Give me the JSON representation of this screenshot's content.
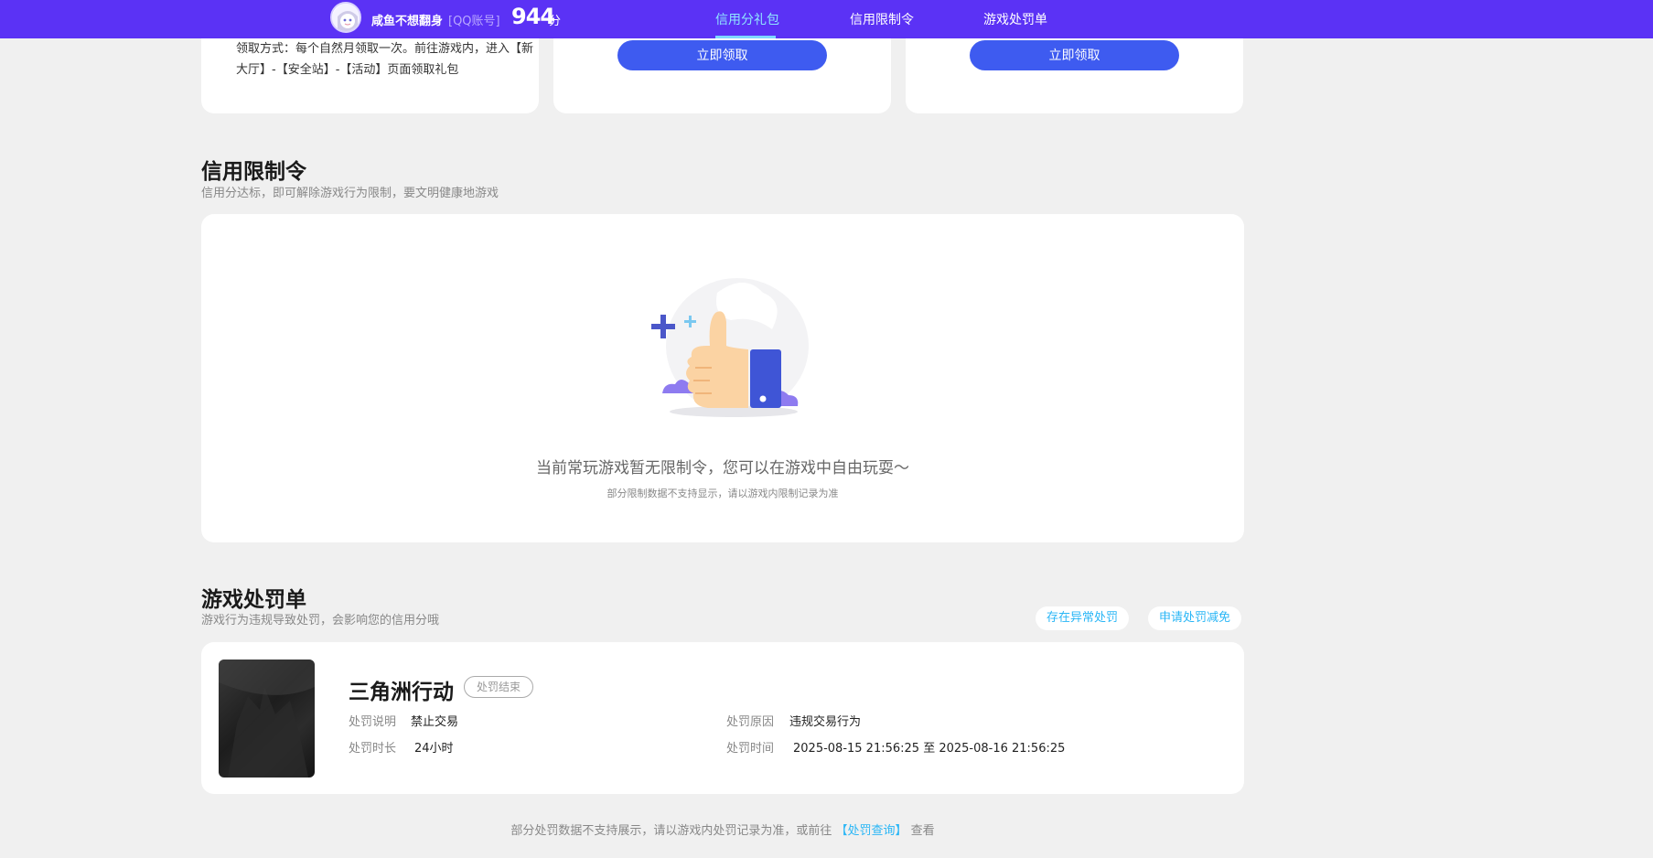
{
  "header": {
    "nickname": "咸鱼不想翻身",
    "account_tag": "[QQ账号]",
    "score": "944",
    "score_unit": "分",
    "nav": [
      {
        "label": "信用分礼包",
        "active": true
      },
      {
        "label": "信用限制令",
        "active": false
      },
      {
        "label": "游戏处罚单",
        "active": false
      }
    ],
    "colors": {
      "bar": "#5b32f5",
      "active": "#8fe6ff"
    }
  },
  "gift_section": {
    "card1_desc": "领取方式：每个自然月领取一次。前往游戏内，进入【新大厅】-【安全站】-【活动】页面领取礼包",
    "card2_button": "立即领取",
    "card3_button": "立即领取",
    "button_color": "#3e5bf0"
  },
  "restriction_section": {
    "title": "信用限制令",
    "subtitle": "信用分达标，即可解除游戏行为限制，要文明健康地游戏",
    "empty_icon": "thumbs-up-icon",
    "empty_message": "当前常玩游戏暂无限制令，您可以在游戏中自由玩耍～",
    "empty_note": "部分限制数据不支持显示，请以游戏内限制记录为准"
  },
  "penalty_section": {
    "title": "游戏处罚单",
    "subtitle": "游戏行为违规导致处罚，会影响您的信用分哦",
    "action_abnormal": "存在异常处罚",
    "action_appeal": "申请处罚减免",
    "records": [
      {
        "game": "三角洲行动",
        "status": "处罚结束",
        "desc_label": "处罚说明",
        "desc_value": "禁止交易",
        "duration_label": "处罚时长",
        "duration_value": "24小时",
        "reason_label": "处罚原因",
        "reason_value": "违规交易行为",
        "time_label": "处罚时间",
        "time_value": "2025-08-15 21:56:25 至 2025-08-16 21:56:25"
      }
    ],
    "footer_prefix": "部分处罚数据不支持展示，请以游戏内处罚记录为准，或前往",
    "footer_link": "【处罚查询】",
    "footer_suffix": "查看"
  }
}
